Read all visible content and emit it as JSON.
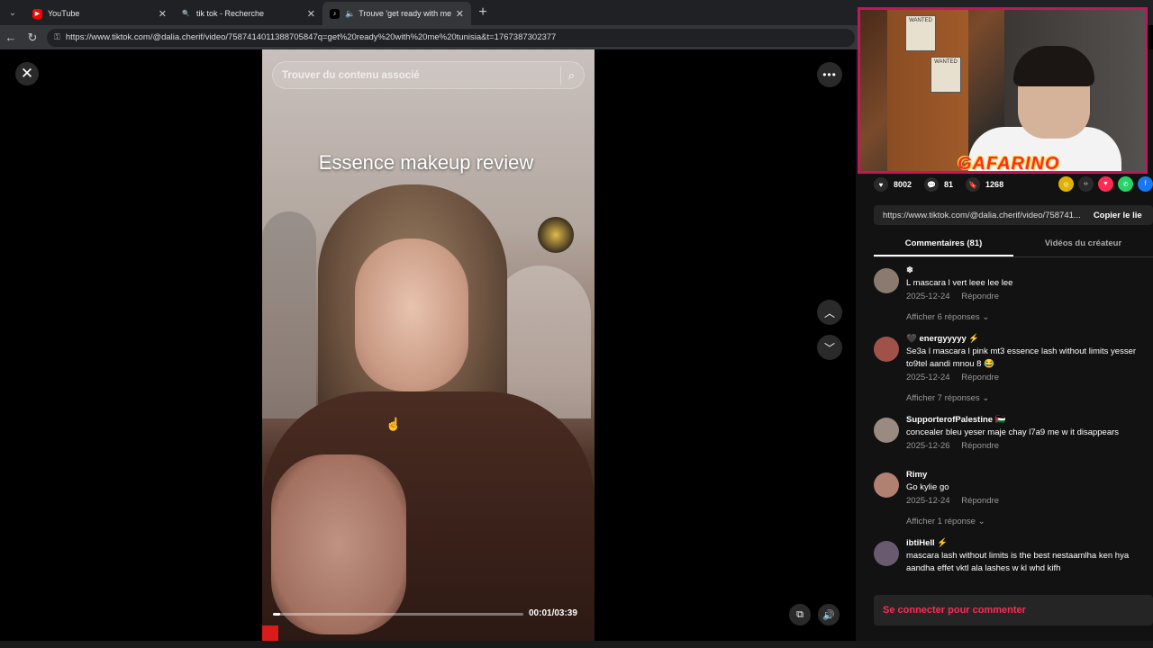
{
  "browser": {
    "tabs": [
      {
        "title": "YouTube",
        "icon": "youtube-icon"
      },
      {
        "title": "tik tok - Recherche",
        "icon": "search-icon"
      },
      {
        "title": "Trouve 'get ready with me tu",
        "icon": "tiktok-icon"
      }
    ],
    "url": "https://www.tiktok.com/@dalia.cherif/video/7587414011388705847q=get%20ready%20with%20me%20tunisia&t=1767387302377"
  },
  "player": {
    "search_placeholder": "Trouver du contenu associé",
    "caption": "Essence makeup review",
    "time": "00:01/03:39",
    "progress_fraction": 0.03
  },
  "overlay": {
    "streamer_name": "GAFARINO",
    "poster_label": "WANTED"
  },
  "stats": {
    "likes": "8002",
    "comments": "81",
    "saves": "1268"
  },
  "link": {
    "url": "https://www.tiktok.com/@dalia.cherif/video/758741...",
    "copy_label": "Copier le lie"
  },
  "panel_tabs": {
    "comments": "Commentaires (81)",
    "creator_videos": "Vidéos du créateur"
  },
  "comments": [
    {
      "name": "❄",
      "text": "L mascara l vert leee lee lee",
      "date": "2025-12-24",
      "reply": "Répondre",
      "replies": "Afficher 6 réponses ⌄",
      "avatar_color": "#8a7a70"
    },
    {
      "name": "🖤 energyyyyy ⚡",
      "text": "Se3a l mascara l pink mt3 essence lash without limits yesser to9tel aandi mnou 8 😂",
      "date": "2025-12-24",
      "reply": "Répondre",
      "replies": "Afficher 7 réponses ⌄",
      "avatar_color": "#a0524a"
    },
    {
      "name": "SupporterofPalestine 🇵🇸",
      "text": "concealer bleu yeser maje chay l7a9 me w it disappears",
      "date": "2025-12-26",
      "reply": "Répondre",
      "replies": "",
      "avatar_color": "#9a8a80"
    },
    {
      "name": "Rimy",
      "text": "Go kylie go",
      "date": "2025-12-24",
      "reply": "Répondre",
      "replies": "Afficher 1 réponse ⌄",
      "avatar_color": "#b08070"
    },
    {
      "name": "ibtiHell ⚡",
      "text": "mascara lash without limits is the best nestaamlha ken hya aandha effet vktl ala lashes w kl whd kifh",
      "date": "",
      "reply": "",
      "replies": "",
      "avatar_color": "#6a5a70"
    }
  ],
  "login_label": "Se connecter pour commenter",
  "colors": {
    "accent": "#fe2c55",
    "webcam_border": "#c2185b"
  }
}
